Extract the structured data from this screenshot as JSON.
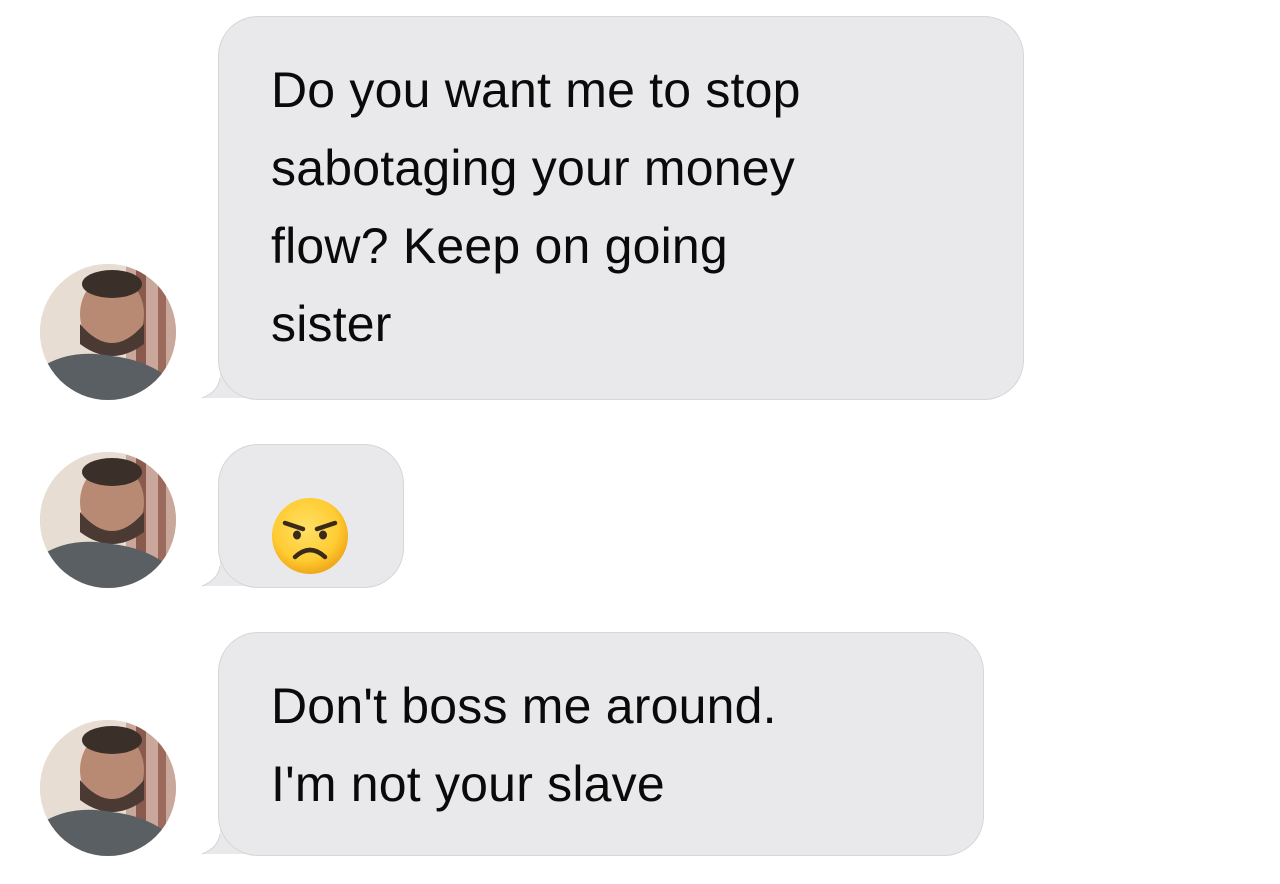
{
  "conversation": {
    "messages": [
      {
        "lines": [
          "Do you want me to stop",
          "sabotaging your money",
          "flow? Keep on going",
          "sister"
        ]
      },
      {
        "emoji": "angry-face-icon"
      },
      {
        "lines": [
          "Don't boss me around.",
          "I'm not your slave"
        ]
      }
    ]
  },
  "colors": {
    "bubble": "#e9e9eb",
    "text": "#0a0a0a",
    "background": "#ffffff"
  }
}
